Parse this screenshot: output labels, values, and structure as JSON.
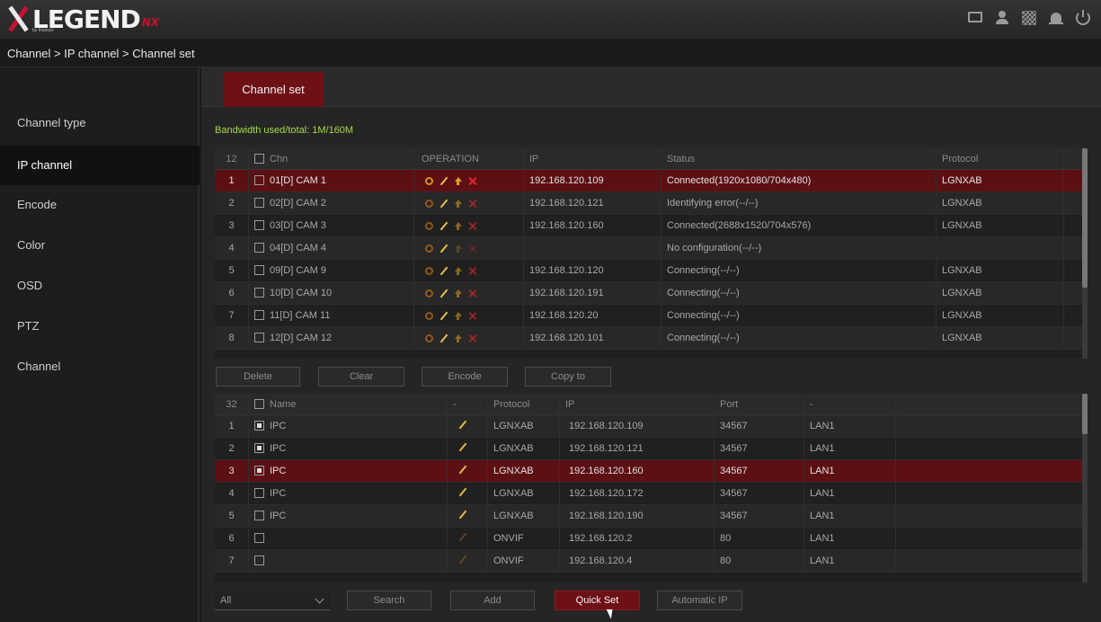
{
  "brand": {
    "name": "LEGEND",
    "suffix": "NX",
    "tagline": "by Inaxsys"
  },
  "header_icons": [
    "monitor-icon",
    "user-icon",
    "qr-code-icon",
    "alarm-icon",
    "power-icon"
  ],
  "breadcrumb": "Channel > IP channel > Channel set",
  "sidebar": {
    "items": [
      {
        "label": "Channel type",
        "active": false
      },
      {
        "label": "IP channel",
        "active": true
      },
      {
        "label": "Encode",
        "active": false
      },
      {
        "label": "Color",
        "active": false
      },
      {
        "label": "OSD",
        "active": false
      },
      {
        "label": "PTZ",
        "active": false
      },
      {
        "label": "Channel",
        "active": false
      }
    ]
  },
  "tab": {
    "label": "Channel set"
  },
  "bandwidth": "Bandwidth used/total: 1M/160M",
  "channels": {
    "count": "12",
    "headers": {
      "chn": "Chn",
      "operation": "OPERATION",
      "ip": "IP",
      "status": "Status",
      "protocol": "Protocol"
    },
    "rows": [
      {
        "num": "1",
        "chn": "01[D] CAM 1",
        "ip": "192.168.120.109",
        "status": "Connected(1920x1080/704x480)",
        "protocol": "LGNXAB"
      },
      {
        "num": "2",
        "chn": "02[D] CAM 2",
        "ip": "192.168.120.121",
        "status": "Identifying error(--/--)",
        "protocol": "LGNXAB"
      },
      {
        "num": "3",
        "chn": "03[D] CAM 3",
        "ip": "192.168.120.160",
        "status": "Connected(2688x1520/704x576)",
        "protocol": "LGNXAB"
      },
      {
        "num": "4",
        "chn": "04[D] CAM 4",
        "ip": "",
        "status": "No configuration(--/--)",
        "protocol": ""
      },
      {
        "num": "5",
        "chn": "09[D] CAM 9",
        "ip": "192.168.120.120",
        "status": "Connecting(--/--)",
        "protocol": "LGNXAB"
      },
      {
        "num": "6",
        "chn": "10[D] CAM 10",
        "ip": "192.168.120.191",
        "status": "Connecting(--/--)",
        "protocol": "LGNXAB"
      },
      {
        "num": "7",
        "chn": "11[D] CAM 11",
        "ip": "192.168.120.20",
        "status": "Connecting(--/--)",
        "protocol": "LGNXAB"
      },
      {
        "num": "8",
        "chn": "12[D] CAM 12",
        "ip": "192.168.120.101",
        "status": "Connecting(--/--)",
        "protocol": "LGNXAB"
      }
    ]
  },
  "channel_actions": {
    "delete": "Delete",
    "clear": "Clear",
    "encode": "Encode",
    "copy_to": "Copy to"
  },
  "devices": {
    "count": "32",
    "headers": {
      "name": "Name",
      "dash1": "-",
      "protocol": "Protocol",
      "ip": "IP",
      "port": "Port",
      "dash2": "-"
    },
    "rows": [
      {
        "num": "1",
        "name": "IPC",
        "checked": true,
        "protocol": "LGNXAB",
        "ip": "192.168.120.109",
        "port": "34567",
        "net": "LAN1"
      },
      {
        "num": "2",
        "name": "IPC",
        "checked": true,
        "protocol": "LGNXAB",
        "ip": "192.168.120.121",
        "port": "34567",
        "net": "LAN1"
      },
      {
        "num": "3",
        "name": "IPC",
        "checked": true,
        "protocol": "LGNXAB",
        "ip": "192.168.120.160",
        "port": "34567",
        "net": "LAN1"
      },
      {
        "num": "4",
        "name": "IPC",
        "checked": false,
        "protocol": "LGNXAB",
        "ip": "192.168.120.172",
        "port": "34567",
        "net": "LAN1"
      },
      {
        "num": "5",
        "name": "IPC",
        "checked": false,
        "protocol": "LGNXAB",
        "ip": "192.168.120.190",
        "port": "34567",
        "net": "LAN1"
      },
      {
        "num": "6",
        "name": "",
        "checked": false,
        "protocol": "ONVIF",
        "ip": "192.168.120.2",
        "port": "80",
        "net": "LAN1"
      },
      {
        "num": "7",
        "name": "",
        "checked": false,
        "protocol": "ONVIF",
        "ip": "192.168.120.4",
        "port": "80",
        "net": "LAN1"
      }
    ]
  },
  "footer": {
    "filter": "All",
    "search": "Search",
    "add": "Add",
    "quick_set": "Quick Set",
    "automatic_ip": "Automatic IP"
  },
  "colors": {
    "accent": "#6d1117",
    "selected_row": "#5c1014",
    "bandwidth_text": "#a7d94a",
    "delete_icon": "#e3262a",
    "gear_icon": "#e28a1e"
  }
}
